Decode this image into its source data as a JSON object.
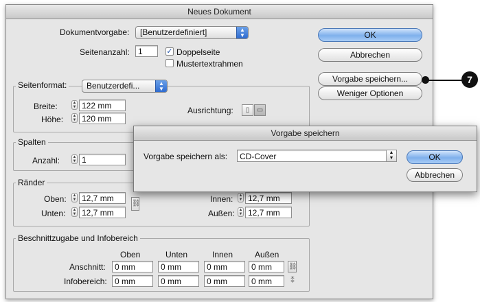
{
  "window": {
    "title": "Neues Dokument"
  },
  "top": {
    "preset_label": "Dokumentvorgabe:",
    "preset_value": "[Benutzerdefiniert]",
    "pages_label": "Seitenanzahl:",
    "pages_value": "1",
    "facing_pages": "Doppelseite",
    "facing_checked": true,
    "master_frame": "Mustertextrahmen",
    "master_checked": false
  },
  "buttons": {
    "ok": "OK",
    "cancel": "Abbrechen",
    "save_preset": "Vorgabe speichern...",
    "fewer_options": "Weniger Optionen"
  },
  "page_size": {
    "label": "Seitenformat:",
    "value": "Benutzerdefi...",
    "width_label": "Breite:",
    "width_value": "122 mm",
    "height_label": "Höhe:",
    "height_value": "120 mm",
    "orientation_label": "Ausrichtung:"
  },
  "columns": {
    "title": "Spalten",
    "count_label": "Anzahl:",
    "count_value": "1"
  },
  "margins": {
    "title": "Ränder",
    "top_label": "Oben:",
    "top_value": "12,7 mm",
    "bottom_label": "Unten:",
    "bottom_value": "12,7 mm",
    "inside_label": "Innen:",
    "inside_value": "12,7 mm",
    "outside_label": "Außen:",
    "outside_value": "12,7 mm"
  },
  "bleed": {
    "title": "Beschnittzugabe und Infobereich",
    "col_top": "Oben",
    "col_bottom": "Unten",
    "col_inside": "Innen",
    "col_outside": "Außen",
    "bleed_label": "Anschnitt:",
    "slug_label": "Infobereich:",
    "bleed_values": [
      "0 mm",
      "0 mm",
      "0 mm",
      "0 mm"
    ],
    "slug_values": [
      "0 mm",
      "0 mm",
      "0 mm",
      "0 mm"
    ]
  },
  "save_dialog": {
    "title": "Vorgabe speichern",
    "name_label": "Vorgabe speichern als:",
    "name_value": "CD-Cover",
    "ok": "OK",
    "cancel": "Abbrechen"
  },
  "callout": {
    "number": "7"
  },
  "icons": {
    "chain": "chain-link-icon",
    "portrait": "portrait-orientation-icon",
    "landscape": "landscape-orientation-icon"
  }
}
